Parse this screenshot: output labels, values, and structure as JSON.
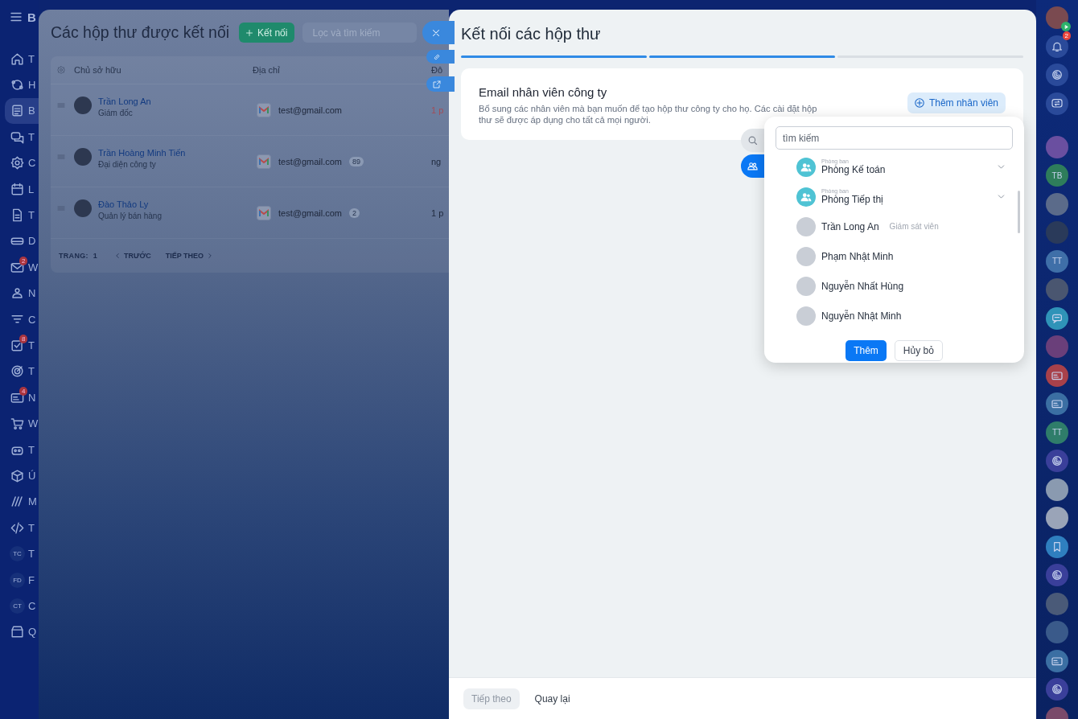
{
  "sidebar": {
    "logo": "B",
    "items": [
      {
        "label": "T",
        "selected": false
      },
      {
        "label": "H",
        "selected": false
      },
      {
        "label": "B",
        "selected": true
      },
      {
        "label": "T",
        "selected": false
      },
      {
        "label": "C",
        "selected": false
      },
      {
        "label": "L",
        "selected": false
      },
      {
        "label": "T",
        "selected": false
      },
      {
        "label": "D",
        "selected": false
      },
      {
        "label": "W",
        "selected": false,
        "badge": "2"
      },
      {
        "label": "N",
        "selected": false
      },
      {
        "label": "C",
        "selected": false
      },
      {
        "label": "T",
        "selected": false,
        "badge": "8"
      },
      {
        "label": "T",
        "selected": false
      },
      {
        "label": "N",
        "selected": false,
        "badge": "4"
      },
      {
        "label": "W",
        "selected": false
      },
      {
        "label": "T",
        "selected": false
      },
      {
        "label": "Ú",
        "selected": false
      },
      {
        "label": "M",
        "selected": false
      },
      {
        "label": "T",
        "selected": false
      },
      {
        "initials": "TC",
        "label": "T",
        "selected": false
      },
      {
        "initials": "FD",
        "label": "F",
        "selected": false
      },
      {
        "initials": "CT",
        "label": "C",
        "selected": false
      },
      {
        "label": "Q",
        "selected": false
      }
    ]
  },
  "mailboxes": {
    "title": "Các hộp thư được kết nối",
    "connect_button": "Kết nối",
    "filter": {
      "placeholder": "Lọc và tìm kiếm"
    },
    "table": {
      "columns": [
        "Chủ sở hữu",
        "Địa chỉ",
        "Đô"
      ],
      "rows": [
        {
          "owner": "Trần Long An",
          "role": "Giám đốc",
          "address": "test@gmail.com",
          "column_3": "1 p",
          "alert": true
        },
        {
          "owner": "Trần Hoàng Minh Tiến",
          "role": "Đại diện công ty",
          "address": "test@gmail.com",
          "count": "89",
          "column_3": "ng",
          "alert": false
        },
        {
          "owner": "Đào Thảo Ly",
          "role": "Quản lý bán hàng",
          "address": "test@gmail.com",
          "count": "2",
          "column_3": "1 p",
          "alert": false
        }
      ]
    },
    "pagination": {
      "page_label": "TRANG:",
      "page": "1",
      "previous": "TRƯỚC",
      "next": "TIẾP THEO"
    }
  },
  "panel": {
    "title": "Kết nối các hộp thư",
    "steps": [
      {
        "completed": true
      },
      {
        "completed": true
      },
      {
        "completed": false
      }
    ],
    "card": {
      "heading": "Email nhân viên công ty",
      "description": "Bổ sung các nhân viên mà bạn muốn để tạo hộp thư công ty cho họ. Các cài đặt hộp thư sẽ được áp dụng cho tất cả mọi người.",
      "add_button": "Thêm nhân viên"
    },
    "picker": {
      "search": {
        "placeholder": "tìm kiếm"
      },
      "items": [
        {
          "kind": "department",
          "caption": "Phòng ban",
          "name": "Phòng Kế toán"
        },
        {
          "kind": "department",
          "caption": "Phòng ban",
          "name": "Phòng Tiếp thị"
        },
        {
          "kind": "person",
          "name": "Trần Long An",
          "role": "Giám sát viên"
        },
        {
          "kind": "person",
          "name": "Phạm Nhật Minh"
        },
        {
          "kind": "person",
          "name": "Nguyễn Nhất Hùng"
        },
        {
          "kind": "person",
          "name": "Nguyễn Nhật Minh"
        }
      ],
      "confirm_button": "Thêm",
      "cancel_button": "Hủy bỏ"
    },
    "footer": {
      "next_button": {
        "label": "Tiếp theo",
        "disabled": true
      },
      "back_button": "Quay lại"
    }
  },
  "right_bar": {
    "items": [
      {
        "kind": "photo",
        "status": true
      },
      {
        "kind": "icon",
        "badge": "2"
      },
      {
        "kind": "icon"
      },
      {
        "kind": "icon"
      },
      {
        "kind": "photo",
        "color": "#6a4fa0"
      },
      {
        "kind": "initials",
        "initials": "TB",
        "color": "#2e7d5b"
      },
      {
        "kind": "photo",
        "color": "#5b6b8a"
      },
      {
        "kind": "photo",
        "color": "#2a3a5a"
      },
      {
        "kind": "initials",
        "initials": "TT",
        "color": "#3f6fa8"
      },
      {
        "kind": "photo",
        "color": "#4a5670"
      },
      {
        "kind": "icon",
        "color": "#2f93b8"
      },
      {
        "kind": "photo",
        "color": "#6a3f7a"
      },
      {
        "kind": "icon",
        "color": "#a8414a"
      },
      {
        "kind": "icon",
        "color": "#3b6fa3"
      },
      {
        "kind": "initials",
        "initials": "TT",
        "color": "#2f7d6a"
      },
      {
        "kind": "icon",
        "color": "#3a3f9a"
      },
      {
        "kind": "photo",
        "color": "#8a9ab0"
      },
      {
        "kind": "photo",
        "color": "#9aa4b8"
      },
      {
        "kind": "icon",
        "color": "#2f7fbf"
      },
      {
        "kind": "icon",
        "color": "#3a3f9a"
      },
      {
        "kind": "photo",
        "color": "#4a5a78"
      },
      {
        "kind": "photo",
        "color": "#3a5a8a"
      },
      {
        "kind": "icon",
        "color": "#3b6fa3"
      },
      {
        "kind": "icon",
        "color": "#3a3f9a"
      },
      {
        "kind": "photo",
        "color": "#7a4a6a"
      }
    ]
  }
}
